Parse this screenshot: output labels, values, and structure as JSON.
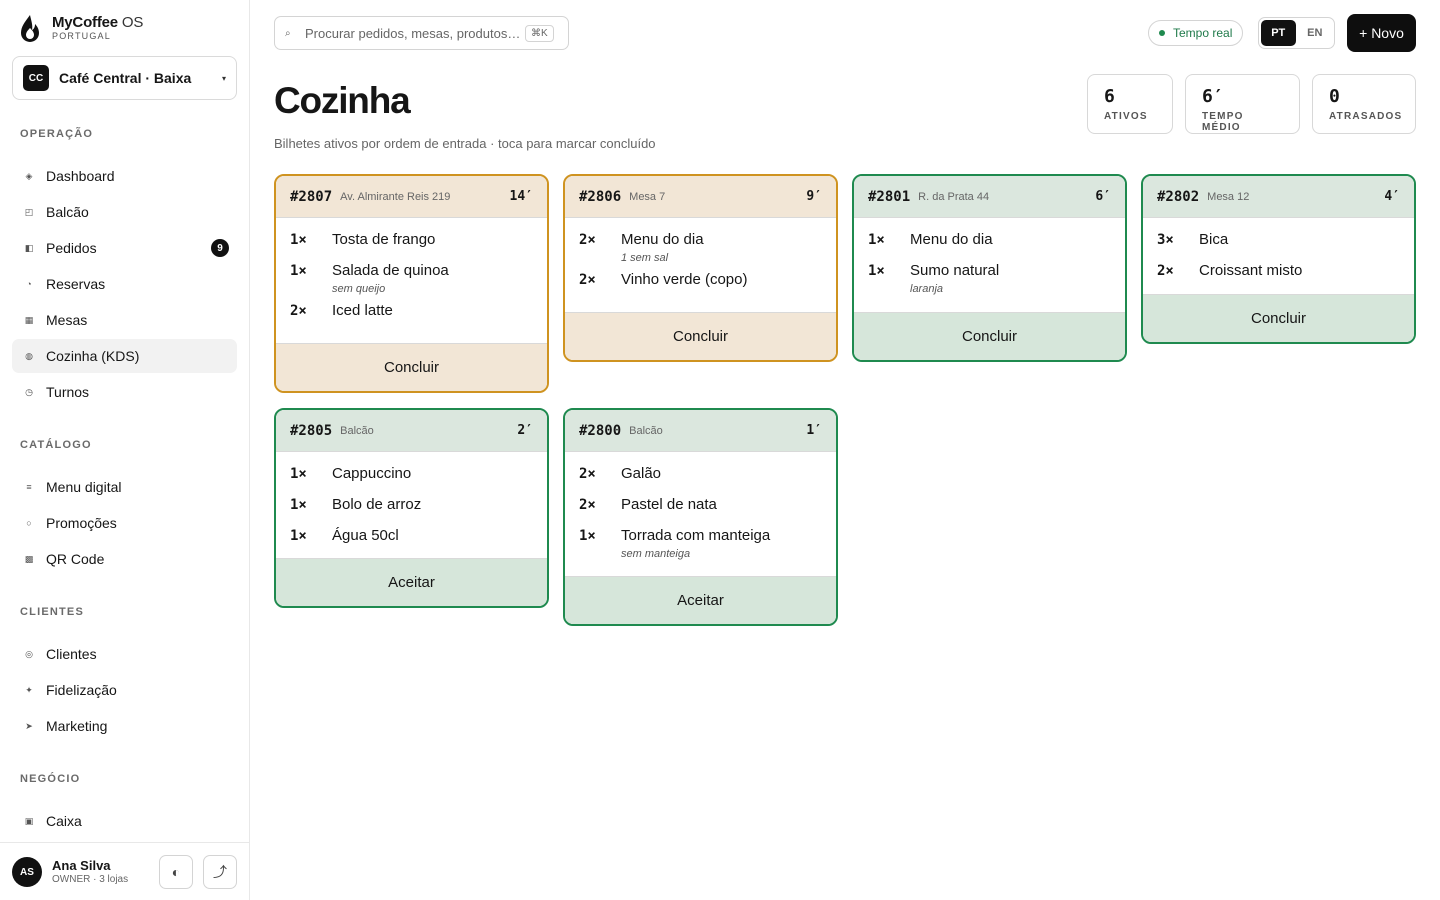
{
  "brand": {
    "name": "MyCoffee",
    "suffix": "OS",
    "region": "PORTUGAL"
  },
  "store": {
    "initials": "CC",
    "name": "Café Central · Baixa"
  },
  "sections": {
    "operacao": "OPERAÇÃO",
    "catalogo": "CATÁLOGO",
    "clientes": "CLIENTES",
    "negocio": "NEGÓCIO"
  },
  "nav": {
    "dashboard": "Dashboard",
    "balcao": "Balcão",
    "pedidos": "Pedidos",
    "pedidos_badge": "9",
    "reservas": "Reservas",
    "mesas": "Mesas",
    "cozinha": "Cozinha (KDS)",
    "turnos": "Turnos",
    "menu_digital": "Menu digital",
    "promocoes": "Promoções",
    "qr_code": "QR Code",
    "clientes": "Clientes",
    "fidelizacao": "Fidelização",
    "marketing": "Marketing",
    "caixa": "Caixa"
  },
  "user": {
    "initials": "AS",
    "name": "Ana Silva",
    "role": "OWNER · 3 lojas"
  },
  "header": {
    "search_placeholder": "Procurar pedidos, mesas, produtos…",
    "shortcut": "⌘K",
    "live": "Tempo real",
    "lang_pt": "PT",
    "lang_en": "EN",
    "new_button": "+ Novo"
  },
  "page": {
    "title": "Cozinha",
    "subtitle": "Bilhetes ativos por ordem de entrada · toca para marcar concluído"
  },
  "stats": [
    {
      "value": "6",
      "label": "ATIVOS"
    },
    {
      "value": "6′",
      "label": "TEMPO MÉDIO"
    },
    {
      "value": "0",
      "label": "ATRASADOS"
    }
  ],
  "colors": {
    "amber": "#cf9320",
    "green": "#1f8a4f"
  },
  "tickets": [
    {
      "id": "#2807",
      "location": "Av. Almirante Reis 219",
      "time": "14′",
      "items": [
        {
          "qty": "1×",
          "name": "Tosta de frango",
          "note": ""
        },
        {
          "qty": "1×",
          "name": "Salada de quinoa",
          "note": "sem queijo"
        },
        {
          "qty": "2×",
          "name": "Iced latte",
          "note": ""
        }
      ],
      "action": "Concluir"
    },
    {
      "id": "#2806",
      "location": "Mesa 7",
      "time": "9′",
      "items": [
        {
          "qty": "2×",
          "name": "Menu do dia",
          "note": "1 sem sal"
        },
        {
          "qty": "2×",
          "name": "Vinho verde (copo)",
          "note": ""
        }
      ],
      "action": "Concluir"
    },
    {
      "id": "#2801",
      "location": "R. da Prata 44",
      "time": "6′",
      "items": [
        {
          "qty": "1×",
          "name": "Menu do dia",
          "note": ""
        },
        {
          "qty": "1×",
          "name": "Sumo natural",
          "note": "laranja"
        }
      ],
      "action": "Concluir"
    },
    {
      "id": "#2802",
      "location": "Mesa 12",
      "time": "4′",
      "items": [
        {
          "qty": "3×",
          "name": "Bica",
          "note": ""
        },
        {
          "qty": "2×",
          "name": "Croissant misto",
          "note": ""
        }
      ],
      "action": "Concluir"
    },
    {
      "id": "#2805",
      "location": "Balcão",
      "time": "2′",
      "items": [
        {
          "qty": "1×",
          "name": "Cappuccino",
          "note": ""
        },
        {
          "qty": "1×",
          "name": "Bolo de arroz",
          "note": ""
        },
        {
          "qty": "1×",
          "name": "Água 50cl",
          "note": ""
        }
      ],
      "action": "Aceitar"
    },
    {
      "id": "#2800",
      "location": "Balcão",
      "time": "1′",
      "items": [
        {
          "qty": "2×",
          "name": "Galão",
          "note": ""
        },
        {
          "qty": "2×",
          "name": "Pastel de nata",
          "note": ""
        },
        {
          "qty": "1×",
          "name": "Torrada com manteiga",
          "note": "sem manteiga"
        }
      ],
      "action": "Aceitar"
    }
  ]
}
